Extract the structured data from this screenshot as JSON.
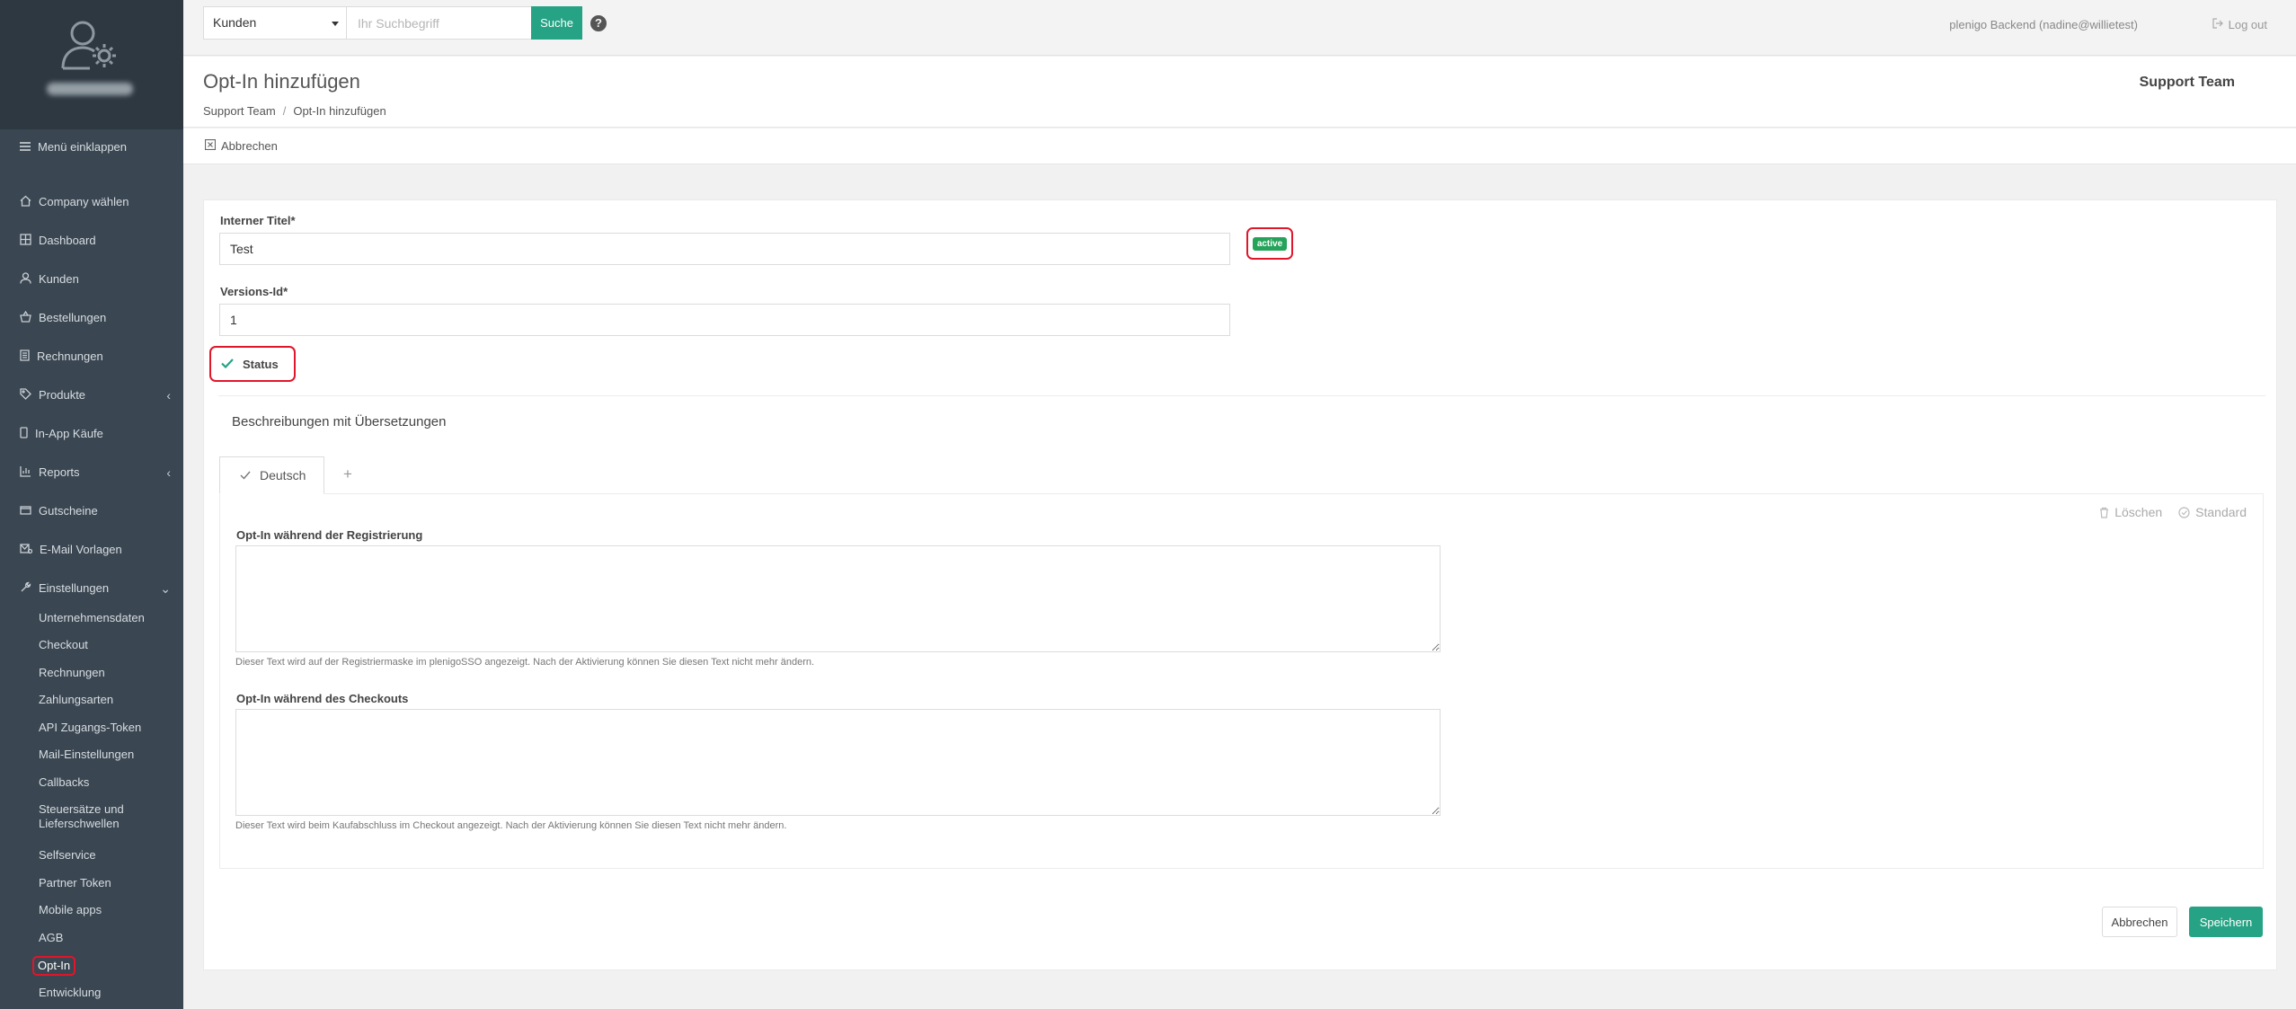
{
  "sidebar": {
    "collapse_label": "Menü einklappen",
    "items": [
      {
        "label": "Company wählen",
        "icon": "home-icon"
      },
      {
        "label": "Dashboard",
        "icon": "grid-icon"
      },
      {
        "label": "Kunden",
        "icon": "user-icon"
      },
      {
        "label": "Bestellungen",
        "icon": "basket-icon"
      },
      {
        "label": "Rechnungen",
        "icon": "receipt-icon"
      },
      {
        "label": "Produkte",
        "icon": "tag-icon"
      },
      {
        "label": "In-App Käufe",
        "icon": "mobile-icon"
      },
      {
        "label": "Reports",
        "icon": "chart-icon"
      },
      {
        "label": "Gutscheine",
        "icon": "ticket-icon"
      },
      {
        "label": "E-Mail Vorlagen",
        "icon": "mail-template-icon"
      },
      {
        "label": "Einstellungen",
        "icon": "wrench-icon"
      }
    ],
    "subitems": [
      "Unternehmensdaten",
      "Checkout",
      "Rechnungen",
      "Zahlungsarten",
      "API Zugangs-Token",
      "Mail-Einstellungen",
      "Callbacks",
      "Steuersätze und Lieferschwellen",
      "Selfservice",
      "Partner Token",
      "Mobile apps",
      "AGB",
      "Opt-In",
      "Entwicklung"
    ]
  },
  "topbar": {
    "search_scope": "Kunden",
    "search_placeholder": "Ihr Suchbegriff",
    "search_button": "Suche",
    "help": "?",
    "user": "plenigo Backend (nadine@willietest)",
    "logout": "Log out"
  },
  "header": {
    "title": "Opt-In hinzufügen",
    "breadcrumb": [
      "Support Team",
      "Opt-In hinzufügen"
    ],
    "team": "Support Team"
  },
  "actionbar": {
    "cancel": "Abbrechen"
  },
  "form": {
    "internal_title_label": "Interner Titel",
    "internal_title_value": "Test",
    "active_badge": "active",
    "version_label": "Versions-Id",
    "version_value": "1",
    "status_label": "Status",
    "section_title": "Beschreibungen mit Übersetzungen",
    "tab_label": "Deutsch",
    "tab_add": "+",
    "delete_label": "Löschen",
    "default_label": "Standard",
    "registration_label": "Opt-In während der Registrierung",
    "registration_hint": "Dieser Text wird auf der Registriermaske im plenigoSSO angezeigt. Nach der Aktivierung können Sie diesen Text nicht mehr ändern.",
    "checkout_label": "Opt-In während des Checkouts",
    "checkout_hint": "Dieser Text wird beim Kaufabschluss im Checkout angezeigt. Nach der Aktivierung können Sie diesen Text nicht mehr ändern.",
    "cancel_button": "Abbrechen",
    "save_button": "Speichern"
  },
  "colors": {
    "sidebar_bg": "#3a4651",
    "accent": "#26a384",
    "active_badge": "#26a35a",
    "highlight": "#e0162b"
  }
}
